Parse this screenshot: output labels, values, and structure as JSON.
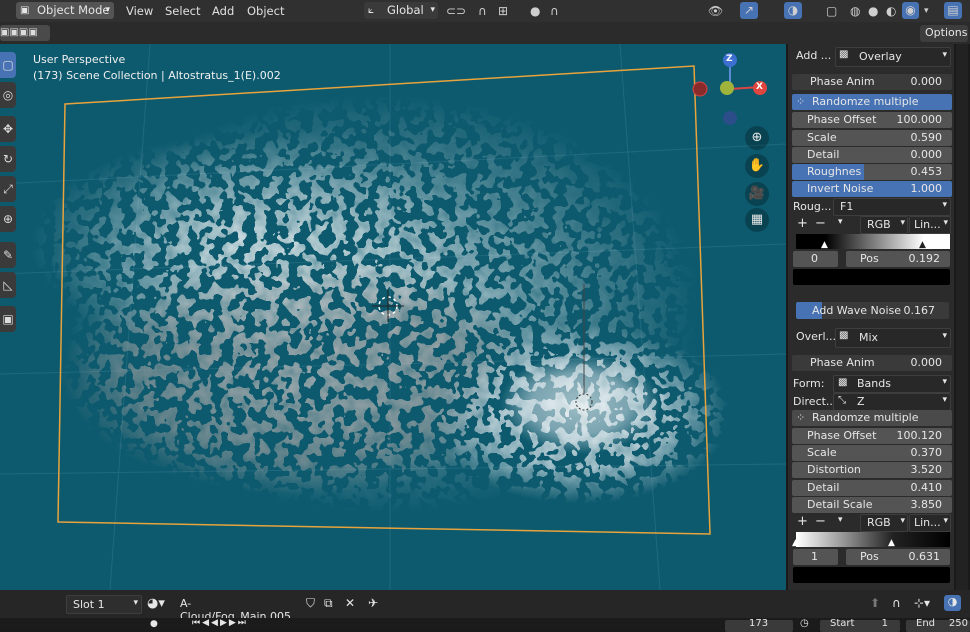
{
  "header": {
    "mode": "Object Mode",
    "menus": [
      "View",
      "Select",
      "Add",
      "Object"
    ],
    "orientation": "Global",
    "options": "Options"
  },
  "viewport": {
    "perspective": "User Perspective",
    "collection": "(173) Scene Collection | Altostratus_1(E).002",
    "gizmo": {
      "z": "Z",
      "x": "X"
    }
  },
  "panel": {
    "add_label": "Add ...",
    "blend1": "Overlay",
    "phase_anim1": {
      "label": "Phase Anim",
      "value": "0.000"
    },
    "randomize1": "Randomze multiple objects",
    "params1": [
      {
        "label": "Phase Offset",
        "value": "100.000",
        "blue": false
      },
      {
        "label": "Scale",
        "value": "0.590",
        "blue": false
      },
      {
        "label": "Detail",
        "value": "0.000",
        "blue": false
      },
      {
        "label": "Roughnes",
        "value": "0.453",
        "blue": true
      },
      {
        "label": "Invert Noise",
        "value": "1.000",
        "blue": true
      }
    ],
    "rough_label": "Roug...",
    "rough_value": "F1",
    "ramp1": {
      "mode": "RGB",
      "interp": "Lin...",
      "index": "0",
      "pos_label": "Pos",
      "pos": "0.192"
    },
    "wave": {
      "label": "Add Wave Noise",
      "value": "0.167"
    },
    "overlay2_label": "Overl...",
    "blend2": "Mix",
    "phase_anim2": {
      "label": "Phase Anim",
      "value": "0.000"
    },
    "form": {
      "label": "Form:",
      "value": "Bands"
    },
    "direction": {
      "label": "Direct...",
      "value": "Z"
    },
    "randomize2": "Randomze multiple objects",
    "params2": [
      {
        "label": "Phase Offset",
        "value": "100.120"
      },
      {
        "label": "Scale",
        "value": "0.370"
      },
      {
        "label": "Distortion",
        "value": "3.520"
      },
      {
        "label": "Detail",
        "value": "0.410"
      },
      {
        "label": "Detail Scale",
        "value": "3.850"
      }
    ],
    "ramp2": {
      "mode": "RGB",
      "interp": "Lin...",
      "index": "1",
      "pos_label": "Pos",
      "pos": "0.631"
    }
  },
  "footer": {
    "slot": "Slot 1",
    "material": "A-Cloud/Fog_Main.005",
    "frame": "173",
    "start_label": "Start",
    "start": "1",
    "end_label": "End",
    "end": "250"
  },
  "colors": {
    "viewport": "#0d5a6e",
    "accent": "#4772b3",
    "outline": "#e8a33c"
  }
}
